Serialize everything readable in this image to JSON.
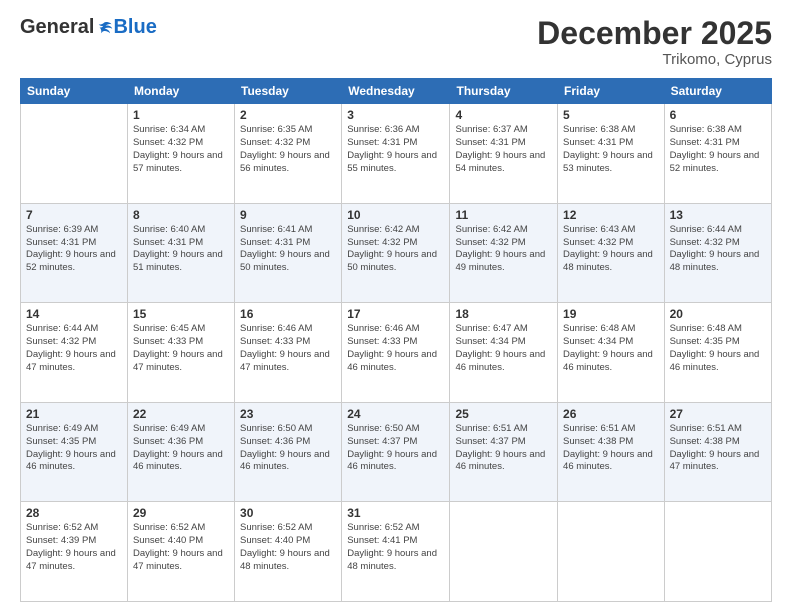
{
  "header": {
    "logo_general": "General",
    "logo_blue": "Blue",
    "month": "December 2025",
    "location": "Trikomo, Cyprus"
  },
  "days_of_week": [
    "Sunday",
    "Monday",
    "Tuesday",
    "Wednesday",
    "Thursday",
    "Friday",
    "Saturday"
  ],
  "weeks": [
    [
      {
        "day": "",
        "sunrise": "",
        "sunset": "",
        "daylight": ""
      },
      {
        "day": "1",
        "sunrise": "Sunrise: 6:34 AM",
        "sunset": "Sunset: 4:32 PM",
        "daylight": "Daylight: 9 hours and 57 minutes."
      },
      {
        "day": "2",
        "sunrise": "Sunrise: 6:35 AM",
        "sunset": "Sunset: 4:32 PM",
        "daylight": "Daylight: 9 hours and 56 minutes."
      },
      {
        "day": "3",
        "sunrise": "Sunrise: 6:36 AM",
        "sunset": "Sunset: 4:31 PM",
        "daylight": "Daylight: 9 hours and 55 minutes."
      },
      {
        "day": "4",
        "sunrise": "Sunrise: 6:37 AM",
        "sunset": "Sunset: 4:31 PM",
        "daylight": "Daylight: 9 hours and 54 minutes."
      },
      {
        "day": "5",
        "sunrise": "Sunrise: 6:38 AM",
        "sunset": "Sunset: 4:31 PM",
        "daylight": "Daylight: 9 hours and 53 minutes."
      },
      {
        "day": "6",
        "sunrise": "Sunrise: 6:38 AM",
        "sunset": "Sunset: 4:31 PM",
        "daylight": "Daylight: 9 hours and 52 minutes."
      }
    ],
    [
      {
        "day": "7",
        "sunrise": "Sunrise: 6:39 AM",
        "sunset": "Sunset: 4:31 PM",
        "daylight": "Daylight: 9 hours and 52 minutes."
      },
      {
        "day": "8",
        "sunrise": "Sunrise: 6:40 AM",
        "sunset": "Sunset: 4:31 PM",
        "daylight": "Daylight: 9 hours and 51 minutes."
      },
      {
        "day": "9",
        "sunrise": "Sunrise: 6:41 AM",
        "sunset": "Sunset: 4:31 PM",
        "daylight": "Daylight: 9 hours and 50 minutes."
      },
      {
        "day": "10",
        "sunrise": "Sunrise: 6:42 AM",
        "sunset": "Sunset: 4:32 PM",
        "daylight": "Daylight: 9 hours and 50 minutes."
      },
      {
        "day": "11",
        "sunrise": "Sunrise: 6:42 AM",
        "sunset": "Sunset: 4:32 PM",
        "daylight": "Daylight: 9 hours and 49 minutes."
      },
      {
        "day": "12",
        "sunrise": "Sunrise: 6:43 AM",
        "sunset": "Sunset: 4:32 PM",
        "daylight": "Daylight: 9 hours and 48 minutes."
      },
      {
        "day": "13",
        "sunrise": "Sunrise: 6:44 AM",
        "sunset": "Sunset: 4:32 PM",
        "daylight": "Daylight: 9 hours and 48 minutes."
      }
    ],
    [
      {
        "day": "14",
        "sunrise": "Sunrise: 6:44 AM",
        "sunset": "Sunset: 4:32 PM",
        "daylight": "Daylight: 9 hours and 47 minutes."
      },
      {
        "day": "15",
        "sunrise": "Sunrise: 6:45 AM",
        "sunset": "Sunset: 4:33 PM",
        "daylight": "Daylight: 9 hours and 47 minutes."
      },
      {
        "day": "16",
        "sunrise": "Sunrise: 6:46 AM",
        "sunset": "Sunset: 4:33 PM",
        "daylight": "Daylight: 9 hours and 47 minutes."
      },
      {
        "day": "17",
        "sunrise": "Sunrise: 6:46 AM",
        "sunset": "Sunset: 4:33 PM",
        "daylight": "Daylight: 9 hours and 46 minutes."
      },
      {
        "day": "18",
        "sunrise": "Sunrise: 6:47 AM",
        "sunset": "Sunset: 4:34 PM",
        "daylight": "Daylight: 9 hours and 46 minutes."
      },
      {
        "day": "19",
        "sunrise": "Sunrise: 6:48 AM",
        "sunset": "Sunset: 4:34 PM",
        "daylight": "Daylight: 9 hours and 46 minutes."
      },
      {
        "day": "20",
        "sunrise": "Sunrise: 6:48 AM",
        "sunset": "Sunset: 4:35 PM",
        "daylight": "Daylight: 9 hours and 46 minutes."
      }
    ],
    [
      {
        "day": "21",
        "sunrise": "Sunrise: 6:49 AM",
        "sunset": "Sunset: 4:35 PM",
        "daylight": "Daylight: 9 hours and 46 minutes."
      },
      {
        "day": "22",
        "sunrise": "Sunrise: 6:49 AM",
        "sunset": "Sunset: 4:36 PM",
        "daylight": "Daylight: 9 hours and 46 minutes."
      },
      {
        "day": "23",
        "sunrise": "Sunrise: 6:50 AM",
        "sunset": "Sunset: 4:36 PM",
        "daylight": "Daylight: 9 hours and 46 minutes."
      },
      {
        "day": "24",
        "sunrise": "Sunrise: 6:50 AM",
        "sunset": "Sunset: 4:37 PM",
        "daylight": "Daylight: 9 hours and 46 minutes."
      },
      {
        "day": "25",
        "sunrise": "Sunrise: 6:51 AM",
        "sunset": "Sunset: 4:37 PM",
        "daylight": "Daylight: 9 hours and 46 minutes."
      },
      {
        "day": "26",
        "sunrise": "Sunrise: 6:51 AM",
        "sunset": "Sunset: 4:38 PM",
        "daylight": "Daylight: 9 hours and 46 minutes."
      },
      {
        "day": "27",
        "sunrise": "Sunrise: 6:51 AM",
        "sunset": "Sunset: 4:38 PM",
        "daylight": "Daylight: 9 hours and 47 minutes."
      }
    ],
    [
      {
        "day": "28",
        "sunrise": "Sunrise: 6:52 AM",
        "sunset": "Sunset: 4:39 PM",
        "daylight": "Daylight: 9 hours and 47 minutes."
      },
      {
        "day": "29",
        "sunrise": "Sunrise: 6:52 AM",
        "sunset": "Sunset: 4:40 PM",
        "daylight": "Daylight: 9 hours and 47 minutes."
      },
      {
        "day": "30",
        "sunrise": "Sunrise: 6:52 AM",
        "sunset": "Sunset: 4:40 PM",
        "daylight": "Daylight: 9 hours and 48 minutes."
      },
      {
        "day": "31",
        "sunrise": "Sunrise: 6:52 AM",
        "sunset": "Sunset: 4:41 PM",
        "daylight": "Daylight: 9 hours and 48 minutes."
      },
      {
        "day": "",
        "sunrise": "",
        "sunset": "",
        "daylight": ""
      },
      {
        "day": "",
        "sunrise": "",
        "sunset": "",
        "daylight": ""
      },
      {
        "day": "",
        "sunrise": "",
        "sunset": "",
        "daylight": ""
      }
    ]
  ]
}
